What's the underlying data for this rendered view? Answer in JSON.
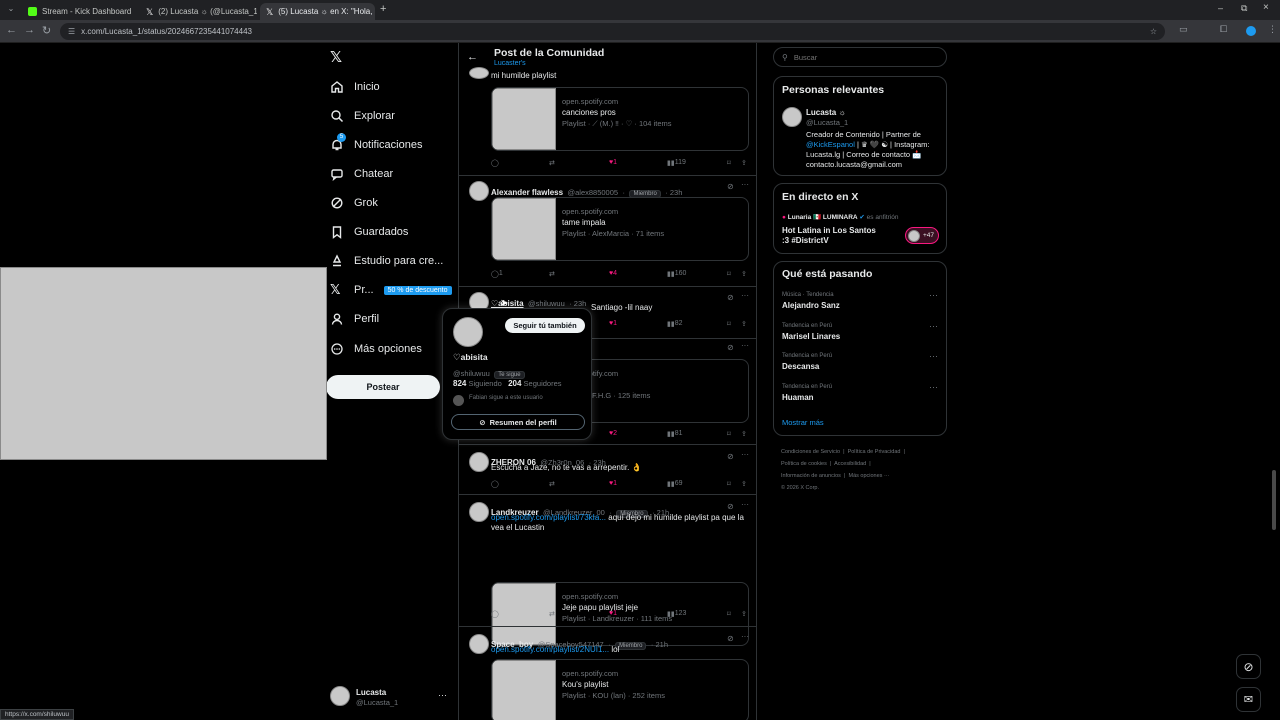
{
  "browser": {
    "tabs": [
      {
        "title": "Stream - Kick Dashboard",
        "color": "#53fc18"
      },
      {
        "title": "(2) Lucasta ☼ (@Lucasta_1) / X",
        "color": "#ffffff"
      },
      {
        "title": "(5) Lucasta ☼ en X: \"Hola, rec...",
        "color": "#ffffff"
      }
    ],
    "new_tab": "+",
    "url": "x.com/Lucasta_1/status/2024667235441074443",
    "status_url": "https://x.com/shiluwuu"
  },
  "nav": {
    "items": [
      {
        "label": "Inicio",
        "icon": "home-icon"
      },
      {
        "label": "Explorar",
        "icon": "search-icon"
      },
      {
        "label": "Notificaciones",
        "icon": "bell-icon"
      },
      {
        "label": "Chatear",
        "icon": "chat-icon"
      },
      {
        "label": "Grok",
        "icon": "grok-icon"
      },
      {
        "label": "Guardados",
        "icon": "bookmark-icon"
      },
      {
        "label": "Estudio para cre...",
        "icon": "studio-icon"
      },
      {
        "label": "Pr...",
        "icon": "x-logo-icon"
      },
      {
        "label": "Perfil",
        "icon": "person-icon"
      },
      {
        "label": "Más opciones",
        "icon": "more-icon"
      }
    ],
    "notif_count": "5",
    "premium_discount": "50 % de descuento",
    "post_button": "Postear",
    "account": {
      "name": "Lucasta",
      "handle": "@Lucasta_1",
      "more": "···"
    }
  },
  "header": {
    "title": "Post de la Comunidad",
    "subtitle": "Lucaster's"
  },
  "posts": [
    {
      "name": "",
      "handle": "",
      "badge": "",
      "time": "",
      "text": "mi humilde playlist",
      "card": {
        "domain": "open.spotify.com",
        "title": "canciones pros",
        "sub": "Playlist · ⟋ (M.) ‼ · ♡ · 104 items"
      },
      "likes": "1",
      "views": "119"
    },
    {
      "name": "Alexander flawless",
      "handle": "@alex8850005",
      "badge": "Miembro",
      "time": "· 23h",
      "text": "",
      "card": {
        "domain": "open.spotify.com",
        "title": "tame impala",
        "sub": "Playlist · AlexMarcia · 71 items"
      },
      "replies": "1",
      "likes": "4",
      "views": "160"
    },
    {
      "name": "♡abisita",
      "handle": "@shiluwuu",
      "badge": "",
      "time": "· 23h",
      "text": "Santiago -lil naay",
      "likes": "1",
      "views": "82"
    },
    {
      "text": "",
      "card": {
        "domain": "open.spotify.com",
        "title": "",
        "sub": "F.H.G · 125 items"
      },
      "likes": "2",
      "views": "81"
    },
    {
      "name": "ZHERON 06",
      "handle": "@Zh3r0n_06",
      "badge": "",
      "time": "· 23h",
      "text": "Escucha a Jaze, no te vas a arrepentir. 👌",
      "likes": "1",
      "views": "69"
    },
    {
      "name": "Landkreuzer",
      "handle": "@Landkreuzer_00",
      "badge": "Miembro",
      "time": "· 21h",
      "link": "open.spotify.com/playlist/73kIa...",
      "text": " aquí dejo mi humilde playlist pa que la vea el  Lucastin",
      "card": {
        "domain": "open.spotify.com",
        "title": "Jeje papu playlist jeje",
        "sub": "Playlist · Landkreuzer · 111 items"
      },
      "likes": "1",
      "views": "123"
    },
    {
      "name": "Space_boy",
      "handle": "@Spaceboy547147",
      "badge": "Miembro",
      "time": "· 21h",
      "link": "open.spotify.com/playlist/2NUI1...",
      "text": " lol",
      "card": {
        "domain": "open.spotify.com",
        "title": "Kou's playlist",
        "sub": "Playlist · KOU (lan) · 252 items"
      }
    }
  ],
  "hover_card": {
    "follow_button": "Seguir tú también",
    "name": "♡abisita",
    "handle": "@shiluwuu",
    "follows_you": "Te sigue",
    "following_count": "824",
    "following_label": "Siguiendo",
    "followers_count": "204",
    "followers_label": "Seguidores",
    "followed_by": "Fabian sigue a este usuario",
    "summary_button": "Resumen del perfil"
  },
  "right": {
    "search_placeholder": "Buscar",
    "relevant": {
      "title": "Personas relevantes",
      "name": "Lucasta ☼",
      "handle": "@Lucasta_1",
      "bio_pre": "Creador de Contenido | Partner de ",
      "bio_link": "@KickEspanol",
      "bio_post": " | ♛ 🖤 ☯ | Instagram: Lucasta.lg | Correo de contacto 📩 contacto.lucasta@gmail.com"
    },
    "live": {
      "title": "En directo en X",
      "host": "Lunaria 🇲🇽 LUMINARA",
      "role": "es anfitrión",
      "event": "Hot Latina in Los Santos :3 #DistrictV",
      "count": "+47"
    },
    "trends": {
      "title": "Qué está pasando",
      "items": [
        {
          "cat": "Música · Tendencia",
          "name": "Alejandro Sanz"
        },
        {
          "cat": "Tendencia en Perú",
          "name": "Marisel Linares"
        },
        {
          "cat": "Tendencia en Perú",
          "name": "Descansa"
        },
        {
          "cat": "Tendencia en Perú",
          "name": "Huaman"
        }
      ],
      "more": "Mostrar más"
    },
    "footer": [
      "Condiciones de Servicio",
      "Política de Privacidad",
      "Política de cookies",
      "Accesibilidad",
      "Información de anuncios",
      "Más opciones ···",
      "© 2026 X Corp."
    ]
  },
  "colors": {
    "accent": "#1d9bf0",
    "like": "#f91880",
    "bg": "#000000",
    "border": "#2f3336"
  }
}
